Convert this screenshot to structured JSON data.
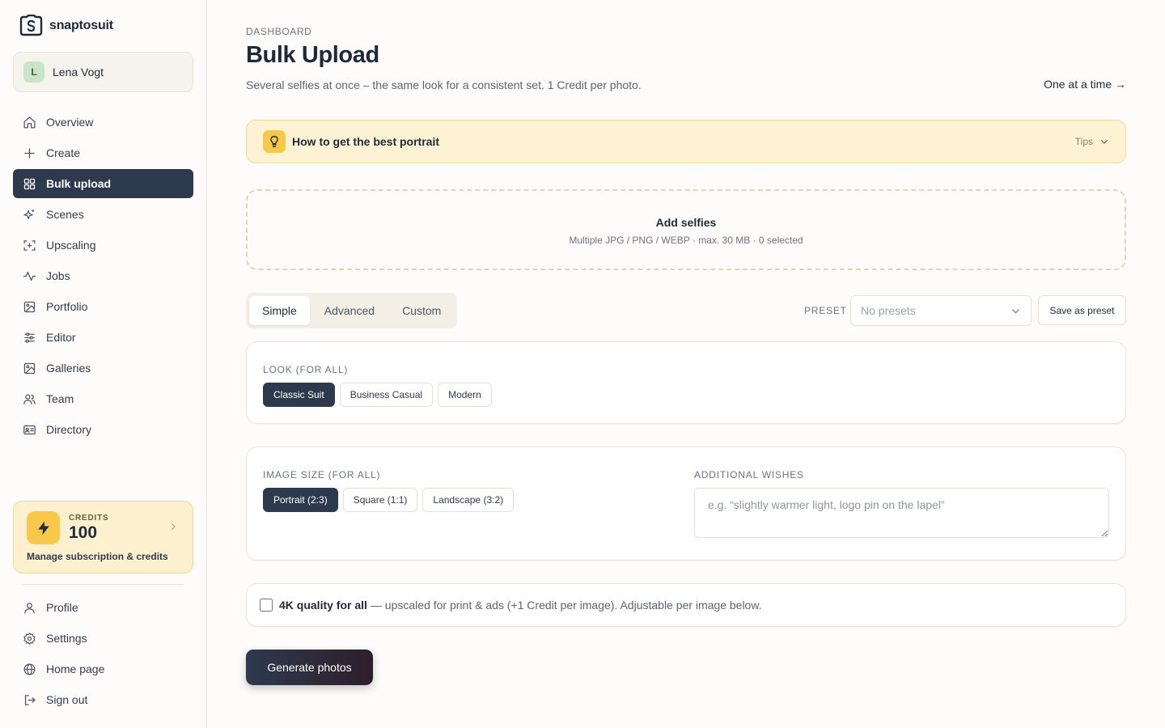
{
  "brand": {
    "name": "snaptosuit"
  },
  "user": {
    "initial": "L",
    "name": "Lena Vogt"
  },
  "sidebar": {
    "items": [
      {
        "label": "Overview",
        "icon": "home-icon"
      },
      {
        "label": "Create",
        "icon": "plus-icon"
      },
      {
        "label": "Bulk upload",
        "icon": "grid-icon",
        "active": true
      },
      {
        "label": "Scenes",
        "icon": "sparkles-icon"
      },
      {
        "label": "Upscaling",
        "icon": "scan-icon"
      },
      {
        "label": "Jobs",
        "icon": "activity-icon"
      },
      {
        "label": "Portfolio",
        "icon": "image-icon"
      },
      {
        "label": "Editor",
        "icon": "sliders-icon"
      },
      {
        "label": "Galleries",
        "icon": "image-icon"
      },
      {
        "label": "Team",
        "icon": "users-icon"
      },
      {
        "label": "Directory",
        "icon": "id-card-icon"
      }
    ],
    "bottom_items": [
      {
        "label": "Profile",
        "icon": "user-icon"
      },
      {
        "label": "Settings",
        "icon": "gear-icon"
      },
      {
        "label": "Home page",
        "icon": "globe-icon"
      },
      {
        "label": "Sign out",
        "icon": "logout-icon"
      }
    ]
  },
  "credits": {
    "label": "CREDITS",
    "value": "100",
    "manage": "Manage subscription & credits"
  },
  "header": {
    "eyebrow": "DASHBOARD",
    "title": "Bulk Upload",
    "subtitle": "Several selfies at once – the same look for a consistent set. 1 Credit per photo.",
    "one_at_a_time": "One at a time →"
  },
  "tips": {
    "title": "How to get the best portrait",
    "toggle_label": "Tips"
  },
  "dropzone": {
    "title": "Add selfies",
    "subtitle": "Multiple JPG / PNG / WEBP · max. 30 MB · 0 selected"
  },
  "mode_tabs": [
    {
      "label": "Simple",
      "active": true
    },
    {
      "label": "Advanced"
    },
    {
      "label": "Custom"
    }
  ],
  "preset": {
    "label": "PRESET",
    "selected": "No presets",
    "save_label": "Save as preset"
  },
  "look": {
    "label": "LOOK (FOR ALL)",
    "options": [
      {
        "label": "Classic Suit",
        "active": true
      },
      {
        "label": "Business Casual"
      },
      {
        "label": "Modern"
      }
    ]
  },
  "image_size": {
    "label": "IMAGE SIZE (FOR ALL)",
    "options": [
      {
        "label": "Portrait (2:3)",
        "active": true
      },
      {
        "label": "Square (1:1)"
      },
      {
        "label": "Landscape (3:2)"
      }
    ]
  },
  "wishes": {
    "label": "ADDITIONAL WISHES",
    "placeholder": "e.g. “slightly warmer light, logo pin on the lapel”",
    "value": ""
  },
  "quality4k": {
    "checked": false,
    "strong": "4K quality for all",
    "rest": "— upscaled for print & ads (+1 Credit per image). Adjustable per image below."
  },
  "generate": {
    "label": "Generate photos"
  },
  "colors": {
    "navy": "#2d3a4e",
    "amber": "#f8c84a",
    "amber_bg": "#fdf2d4"
  }
}
